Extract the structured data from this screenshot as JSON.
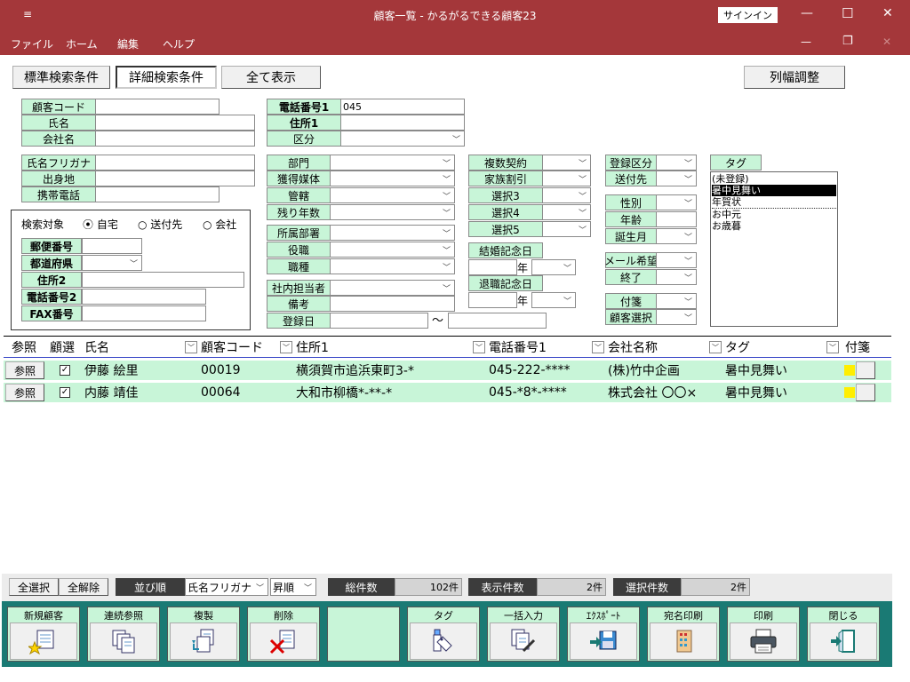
{
  "titlebar": {
    "menu_glyph": "≡",
    "title": "顧客一覧 - かるがるできる顧客23",
    "signin": "サインイン",
    "min": "—",
    "max": "☐",
    "close": "✕"
  },
  "menubar": {
    "items": [
      "ファイル",
      "ホーム",
      "編集",
      "ヘルプ"
    ],
    "min": "—",
    "restore": "❐",
    "close": "✕"
  },
  "tabs": {
    "standard": "標準検索条件",
    "detail": "詳細検索条件",
    "all": "全て表示",
    "colwidth": "列幅調整"
  },
  "search": {
    "customer_code": "顧客コード",
    "name": "氏名",
    "company": "会社名",
    "name_kana": "氏名フリガナ",
    "birthplace": "出身地",
    "mobile": "携帯電話",
    "tel1": "電話番号1",
    "tel1_value": "045",
    "addr1": "住所1",
    "category": "区分",
    "target_label": "検索対象",
    "target_home": "自宅",
    "target_send": "送付先",
    "target_company": "会社",
    "zip": "郵便番号",
    "pref": "都道府県",
    "addr2": "住所2",
    "tel2": "電話番号2",
    "fax": "FAX番号",
    "dept": "部門",
    "media": "獲得媒体",
    "jurisdiction": "管轄",
    "remaining": "残り年数",
    "section": "所属部署",
    "role": "役職",
    "job": "職種",
    "staff": "社内担当者",
    "remarks": "備考",
    "regdate": "登録日",
    "tilde": "〜",
    "multi": "複数契約",
    "family": "家族割引",
    "sel3": "選択3",
    "sel4": "選択4",
    "sel5": "選択5",
    "wedding": "結婚記念日",
    "retire": "退職記念日",
    "year": "年",
    "reg_type": "登録区分",
    "send_to": "送付先",
    "gender": "性別",
    "age": "年齢",
    "birth_month": "誕生月",
    "mail": "メール希望",
    "end": "終了",
    "sticky": "付箋",
    "cust_select": "顧客選択",
    "tag": "タグ",
    "tag_options": [
      "(未登録)",
      "暑中見舞い",
      "年賀状",
      "お中元",
      "お歳暮"
    ]
  },
  "table": {
    "headers": {
      "ref": "参照",
      "sel": "顧選",
      "name": "氏名",
      "code": "顧客コード",
      "addr": "住所1",
      "tel": "電話番号1",
      "company": "会社名称",
      "tag": "タグ",
      "sticky": "付箋"
    },
    "ref_button": "参照",
    "rows": [
      {
        "name": "伊藤 絵里",
        "code": "00019",
        "addr": "横須賀市追浜東町3-*",
        "tel": "045-222-****",
        "company": "(株)竹中企画",
        "tag": "暑中見舞い"
      },
      {
        "name": "内藤 靖佳",
        "code": "00064",
        "addr": "大和市柳橋*-**-*",
        "tel": "045-*8*-****",
        "company": "株式会社 〇〇×",
        "tag": "暑中見舞い"
      }
    ],
    "sticky_color": "#ffee00"
  },
  "status": {
    "select_all": "全選択",
    "clear_all": "全解除",
    "sort_label": "並び順",
    "sort_field": "氏名フリガナ",
    "sort_order": "昇順",
    "total_label": "総件数",
    "total_value": "102件",
    "shown_label": "表示件数",
    "shown_value": "2件",
    "selected_label": "選択件数",
    "selected_value": "2件"
  },
  "actions": [
    {
      "label": "新規顧客",
      "icon": "new-customer-icon"
    },
    {
      "label": "連続参照",
      "icon": "continuous-view-icon"
    },
    {
      "label": "複製",
      "icon": "duplicate-icon"
    },
    {
      "label": "削除",
      "icon": "delete-icon"
    },
    {
      "label": "",
      "icon": ""
    },
    {
      "label": "タグ",
      "icon": "tag-icon"
    },
    {
      "label": "一括入力",
      "icon": "bulk-input-icon"
    },
    {
      "label": "ｴｸｽﾎﾟｰﾄ",
      "icon": "export-icon"
    },
    {
      "label": "宛名印刷",
      "icon": "address-print-icon"
    },
    {
      "label": "印刷",
      "icon": "printer-icon"
    },
    {
      "label": "閉じる",
      "icon": "exit-icon"
    }
  ],
  "colors": {
    "titlebar": "#a4373a",
    "panel": "#c8f5d8",
    "footer": "#1a7a74"
  }
}
